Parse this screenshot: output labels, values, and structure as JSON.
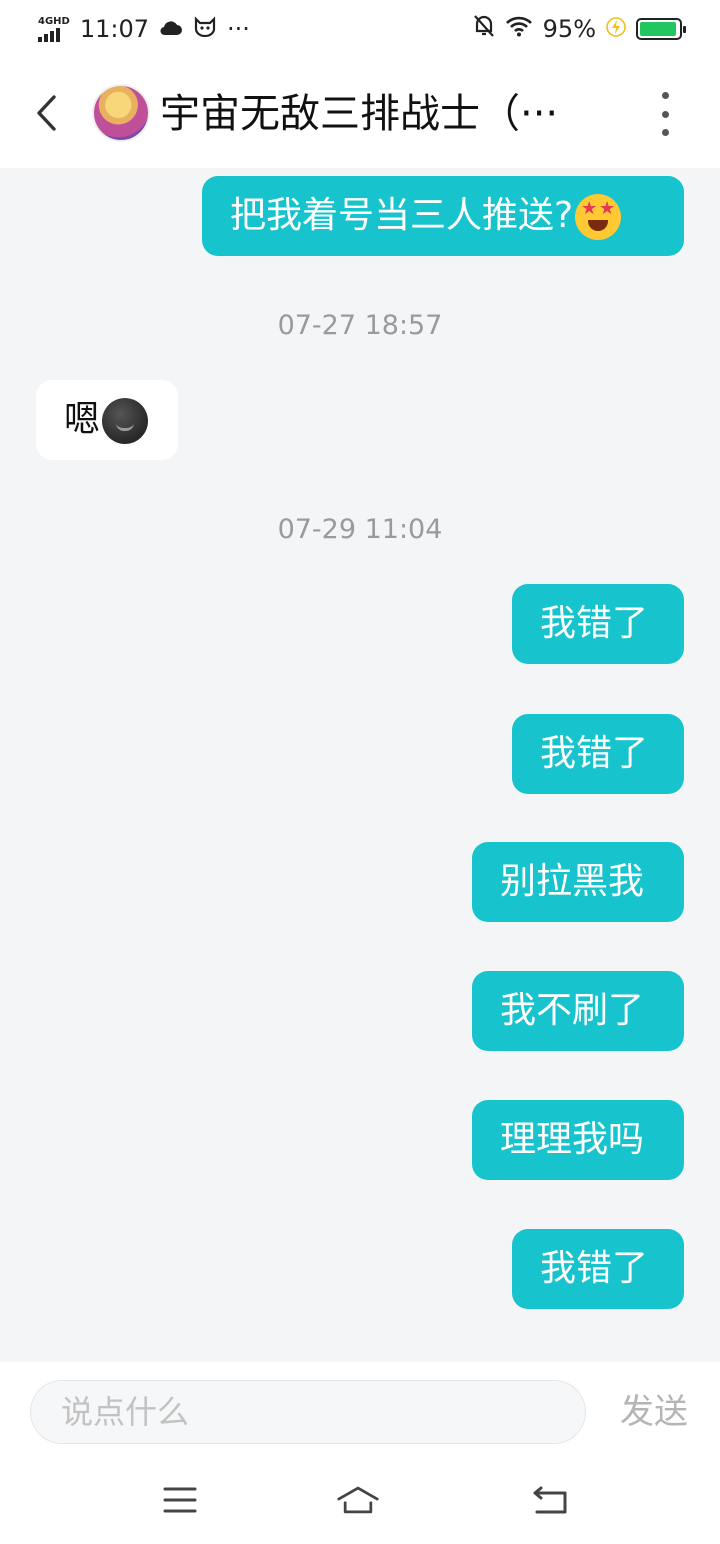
{
  "status_bar": {
    "network": "4GHD",
    "time": "11:07",
    "icons": [
      "cloud-icon",
      "cat-icon",
      "more-dots-icon",
      "mute-bell-icon",
      "wifi-icon",
      "charging-icon",
      "battery-icon"
    ],
    "notif_dots": "···",
    "battery_percent": "95%",
    "battery_level": 0.95
  },
  "header": {
    "title": "宇宙无敌三排战士（···",
    "back_icon": "chevron-left-icon",
    "menu_icon": "vertical-dots-icon"
  },
  "messages": [
    {
      "from": "me",
      "text": "把我着号当三人推送?",
      "emoji": "star-struck-emoji"
    },
    {
      "type": "timestamp",
      "text": "07-27 18:57"
    },
    {
      "from": "other",
      "text": "嗯",
      "emoji": "new-moon-face-emoji"
    },
    {
      "type": "timestamp",
      "text": "07-29 11:04"
    },
    {
      "from": "me",
      "text": "我错了"
    },
    {
      "from": "me",
      "text": "我错了"
    },
    {
      "from": "me",
      "text": "别拉黑我"
    },
    {
      "from": "me",
      "text": "我不刷了"
    },
    {
      "from": "me",
      "text": "理理我吗"
    },
    {
      "from": "me",
      "text": "我错了"
    }
  ],
  "input": {
    "placeholder": "说点什么",
    "value": "",
    "send_label": "发送"
  },
  "nav": {
    "menu_icon": "menu-icon",
    "home_icon": "home-icon",
    "back_icon": "return-icon"
  },
  "colors": {
    "bubble_mine": "#17c3cc",
    "bubble_theirs": "#ffffff",
    "background": "#f4f5f7",
    "battery": "#22c55e"
  }
}
